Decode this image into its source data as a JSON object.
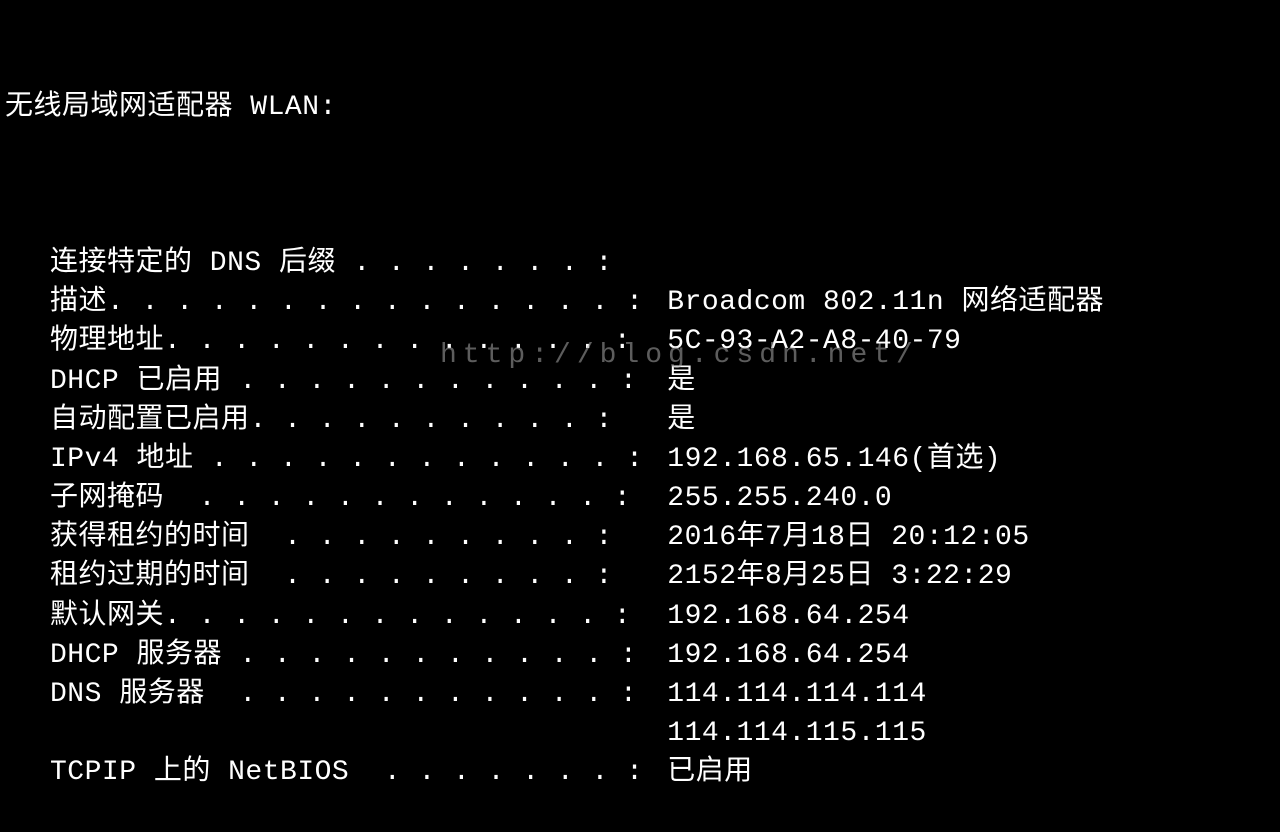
{
  "header": "无线局域网适配器 WLAN:",
  "rows": [
    {
      "label": "连接特定的 DNS 后缀 . . . . . . . :",
      "value": ""
    },
    {
      "label": "描述. . . . . . . . . . . . . . . :",
      "value": "Broadcom 802.11n 网络适配器"
    },
    {
      "label": "物理地址. . . . . . . . . . . . . :",
      "value": "5C-93-A2-A8-40-79"
    },
    {
      "label": "DHCP 已启用 . . . . . . . . . . . :",
      "value": "是"
    },
    {
      "label": "自动配置已启用. . . . . . . . . . :",
      "value": "是"
    },
    {
      "label": "IPv4 地址 . . . . . . . . . . . . :",
      "value": "192.168.65.146(首选)"
    },
    {
      "label": "子网掩码  . . . . . . . . . . . . :",
      "value": "255.255.240.0"
    },
    {
      "label": "获得租约的时间  . . . . . . . . . :",
      "value": "2016年7月18日 20:12:05"
    },
    {
      "label": "租约过期的时间  . . . . . . . . . :",
      "value": "2152年8月25日 3:22:29"
    },
    {
      "label": "默认网关. . . . . . . . . . . . . :",
      "value": "192.168.64.254"
    },
    {
      "label": "DHCP 服务器 . . . . . . . . . . . :",
      "value": "192.168.64.254"
    },
    {
      "label": "DNS 服务器  . . . . . . . . . . . :",
      "value": "114.114.114.114"
    },
    {
      "label": "                                   ",
      "value": "114.114.115.115"
    },
    {
      "label": "TCPIP 上的 NetBIOS  . . . . . . . :",
      "value": "已启用"
    }
  ],
  "watermark": "http://blog.csdn.net/"
}
